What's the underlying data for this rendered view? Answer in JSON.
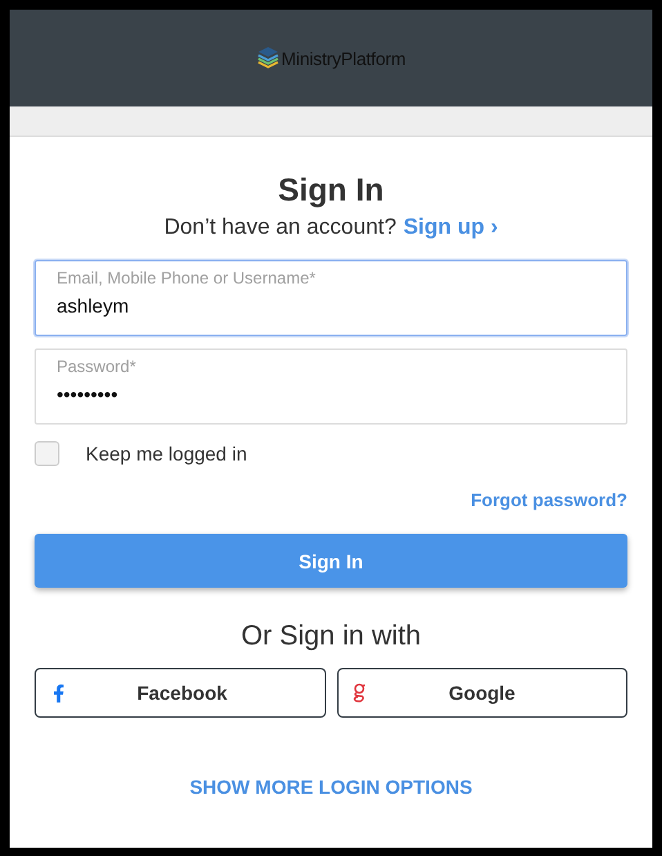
{
  "header": {
    "logo_text": "MinistryPlatform"
  },
  "title": "Sign In",
  "signup_prompt": {
    "text": "Don’t have an account?",
    "link": "Sign up ›"
  },
  "fields": [
    {
      "label": "Email, Mobile Phone or Username*",
      "value": "ashleym",
      "focused": true
    },
    {
      "label": "Password*",
      "value": "•••••••••",
      "focused": false
    }
  ],
  "remember": {
    "label": "Keep me logged in",
    "checked": false
  },
  "forgot_link": "Forgot password?",
  "submit_button": "Sign In",
  "social_heading": "Or Sign in with",
  "social_buttons": [
    {
      "kind": "facebook",
      "label": "Facebook"
    },
    {
      "kind": "google",
      "label": "Google"
    }
  ],
  "more_options_link": "SHOW MORE LOGIN OPTIONS"
}
